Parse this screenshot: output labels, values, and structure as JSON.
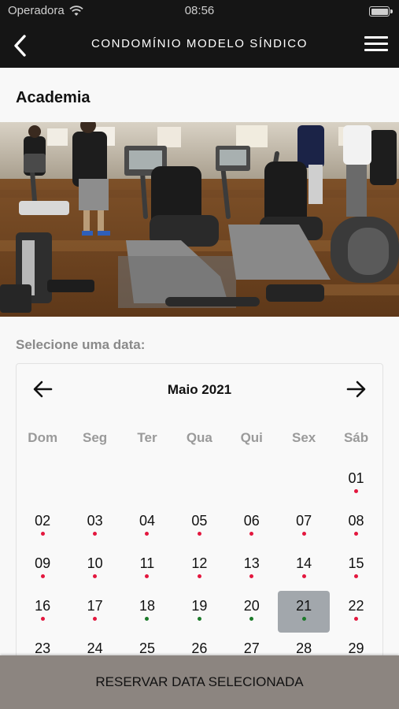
{
  "status_bar": {
    "carrier": "Operadora",
    "time": "08:56"
  },
  "nav": {
    "title": "CONDOMÍNIO MODELO SÍNDICO"
  },
  "page": {
    "title": "Academia",
    "select_label": "Selecione uma data:"
  },
  "calendar": {
    "month_label": "Maio 2021",
    "weekdays": [
      "Dom",
      "Seg",
      "Ter",
      "Qua",
      "Qui",
      "Sex",
      "Sáb"
    ],
    "leading_blanks": 6,
    "selected_day": "21",
    "dot_colors": {
      "unavailable": "#e3173e",
      "available": "#1c7a2a"
    },
    "days": [
      {
        "label": "01",
        "dot": "unavailable"
      },
      {
        "label": "02",
        "dot": "unavailable"
      },
      {
        "label": "03",
        "dot": "unavailable"
      },
      {
        "label": "04",
        "dot": "unavailable"
      },
      {
        "label": "05",
        "dot": "unavailable"
      },
      {
        "label": "06",
        "dot": "unavailable"
      },
      {
        "label": "07",
        "dot": "unavailable"
      },
      {
        "label": "08",
        "dot": "unavailable"
      },
      {
        "label": "09",
        "dot": "unavailable"
      },
      {
        "label": "10",
        "dot": "unavailable"
      },
      {
        "label": "11",
        "dot": "unavailable"
      },
      {
        "label": "12",
        "dot": "unavailable"
      },
      {
        "label": "13",
        "dot": "unavailable"
      },
      {
        "label": "14",
        "dot": "unavailable"
      },
      {
        "label": "15",
        "dot": "unavailable"
      },
      {
        "label": "16",
        "dot": "unavailable"
      },
      {
        "label": "17",
        "dot": "unavailable"
      },
      {
        "label": "18",
        "dot": "available"
      },
      {
        "label": "19",
        "dot": "available"
      },
      {
        "label": "20",
        "dot": "available"
      },
      {
        "label": "21",
        "dot": "available"
      },
      {
        "label": "22",
        "dot": "unavailable"
      },
      {
        "label": "23",
        "dot": "unavailable"
      },
      {
        "label": "24",
        "dot": "unavailable"
      },
      {
        "label": "25",
        "dot": "unavailable"
      },
      {
        "label": "26",
        "dot": "unavailable"
      },
      {
        "label": "27",
        "dot": "unavailable"
      },
      {
        "label": "28",
        "dot": "unavailable"
      },
      {
        "label": "29",
        "dot": "unavailable"
      }
    ]
  },
  "action": {
    "reserve_label": "RESERVAR DATA SELECIONADA"
  },
  "icons": {
    "back": "chevron-left-icon",
    "menu": "hamburger-menu-icon",
    "prev_month": "arrow-left-icon",
    "next_month": "arrow-right-icon"
  }
}
